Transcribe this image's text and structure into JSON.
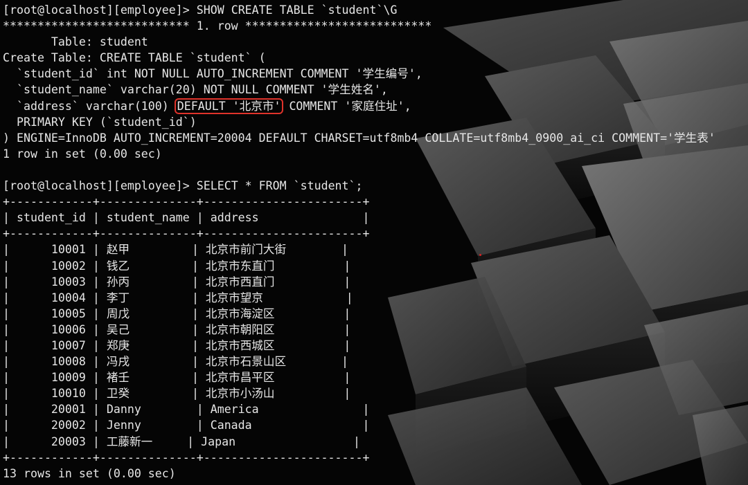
{
  "terminal": {
    "prompt": "[root@localhost][employee]>",
    "show_create": {
      "command": "SHOW CREATE TABLE `student`\\G",
      "row_banner": "*************************** 1. row ***************************",
      "table_line": "       Table: student",
      "create_line": "Create Table: CREATE TABLE `student` (",
      "col1": "  `student_id` int NOT NULL AUTO_INCREMENT COMMENT '学生编号',",
      "col2": "  `student_name` varchar(20) NOT NULL COMMENT '学生姓名',",
      "col3_pre": "  `address` varchar(100) ",
      "col3_highlight": "DEFAULT '北京市'",
      "col3_post": " COMMENT '家庭住址',",
      "pk": "  PRIMARY KEY (`student_id`)",
      "engine": ") ENGINE=InnoDB AUTO_INCREMENT=20004 DEFAULT CHARSET=utf8mb4 COLLATE=utf8mb4_0900_ai_ci COMMENT='学生表'",
      "result": "1 row in set (0.00 sec)"
    },
    "select": {
      "command": "SELECT * FROM `student`;",
      "border": "+------------+--------------+-----------------------+",
      "headers": [
        "student_id",
        "student_name",
        "address"
      ],
      "rows": [
        [
          "10001",
          "赵甲",
          "北京市前门大街"
        ],
        [
          "10002",
          "钱乙",
          "北京市东直门"
        ],
        [
          "10003",
          "孙丙",
          "北京市西直门"
        ],
        [
          "10004",
          "李丁",
          "北京市望京"
        ],
        [
          "10005",
          "周戊",
          "北京市海淀区"
        ],
        [
          "10006",
          "吴己",
          "北京市朝阳区"
        ],
        [
          "10007",
          "郑庚",
          "北京市西城区"
        ],
        [
          "10008",
          "冯戌",
          "北京市石景山区"
        ],
        [
          "10009",
          "褚壬",
          "北京市昌平区"
        ],
        [
          "10010",
          "卫癸",
          "北京市小汤山"
        ],
        [
          "20001",
          "Danny",
          "America"
        ],
        [
          "20002",
          "Jenny",
          "Canada"
        ],
        [
          "20003",
          "工藤新一",
          "Japan"
        ]
      ],
      "result": "13 rows in set (0.00 sec)"
    },
    "colors": {
      "text": "#e6e6e6",
      "highlight_border": "#e0332b"
    }
  }
}
